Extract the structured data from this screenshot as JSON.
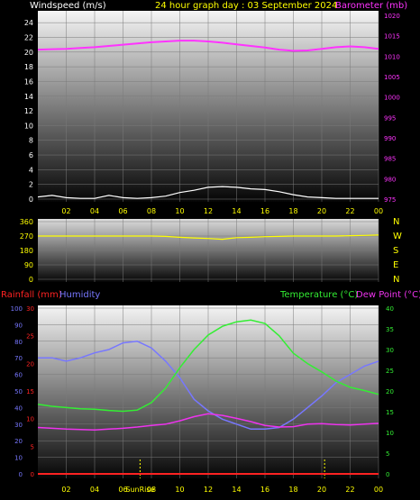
{
  "header": {
    "left_label": "Windspeed (m/s)",
    "center_label": "24 hour graph day : 03 September 2024",
    "right_label": "Barometer (mb)"
  },
  "middle": {
    "directions": [
      "N",
      "W",
      "S",
      "E",
      "N"
    ]
  },
  "bottom": {
    "rain_label": "Rainfall (mm)",
    "hum_label": "Humidity",
    "temp_label": "Temperature (°C)",
    "dew_label": "Dew Point (°C)",
    "sunrise_label": "SunRise"
  },
  "colors": {
    "wind": "#ffffff",
    "barometer": "#ff33ff",
    "direction": "#ffff00",
    "humidity": "#7777ff",
    "temperature": "#33ee33",
    "dewpoint": "#ee33ee",
    "rain": "#ff2222",
    "axis_text": "#ffff00"
  },
  "chart_data": [
    {
      "type": "line",
      "title": "24 hour graph day : 03 September 2024",
      "x": [
        0,
        1,
        2,
        3,
        4,
        5,
        6,
        7,
        8,
        9,
        10,
        11,
        12,
        13,
        14,
        15,
        16,
        17,
        18,
        19,
        20,
        21,
        22,
        23,
        24
      ],
      "x_ticks": [
        "02",
        "04",
        "06",
        "08",
        "10",
        "12",
        "14",
        "16",
        "18",
        "20",
        "22",
        "00"
      ],
      "y_left_label": "Windspeed (m/s)",
      "y_left_lim": [
        0,
        25
      ],
      "y_left_ticks": [
        0,
        2,
        4,
        6,
        8,
        10,
        12,
        14,
        16,
        18,
        20,
        22,
        24
      ],
      "y_right_label": "Barometer (mb)",
      "y_right_lim": [
        975,
        1020
      ],
      "y_right_ticks": [
        975,
        980,
        985,
        990,
        995,
        1000,
        1005,
        1010,
        1015,
        1020
      ],
      "series": [
        {
          "name": "Barometer (mb)",
          "axis": "right",
          "values": [
            1011.6,
            1011.7,
            1011.8,
            1012.0,
            1012.2,
            1012.5,
            1012.8,
            1013.1,
            1013.4,
            1013.6,
            1013.8,
            1013.8,
            1013.6,
            1013.3,
            1012.9,
            1012.5,
            1012.1,
            1011.6,
            1011.3,
            1011.4,
            1011.8,
            1012.2,
            1012.4,
            1012.2,
            1011.8
          ]
        },
        {
          "name": "Windspeed (m/s)",
          "axis": "left",
          "values": [
            0.3,
            0.5,
            0.2,
            0.1,
            0.1,
            0.5,
            0.2,
            0.1,
            0.2,
            0.4,
            0.9,
            1.2,
            1.6,
            1.7,
            1.6,
            1.4,
            1.3,
            1.0,
            0.6,
            0.3,
            0.2,
            0.1,
            0.1,
            0.1,
            0.1
          ]
        }
      ]
    },
    {
      "type": "line",
      "x": [
        0,
        1,
        2,
        3,
        4,
        5,
        6,
        7,
        8,
        9,
        10,
        11,
        12,
        13,
        14,
        15,
        16,
        17,
        18,
        19,
        20,
        21,
        22,
        23,
        24
      ],
      "y_lim": [
        0,
        360
      ],
      "y_ticks": [
        0,
        90,
        180,
        270,
        360
      ],
      "series": [
        {
          "name": "Wind Direction",
          "values": [
            270,
            270,
            270,
            270,
            270,
            270,
            270,
            270,
            270,
            268,
            262,
            258,
            255,
            250,
            260,
            262,
            266,
            268,
            270,
            270,
            270,
            270,
            272,
            274,
            276
          ]
        }
      ]
    },
    {
      "type": "line",
      "x": [
        0,
        1,
        2,
        3,
        4,
        5,
        6,
        7,
        8,
        9,
        10,
        11,
        12,
        13,
        14,
        15,
        16,
        17,
        18,
        19,
        20,
        21,
        22,
        23,
        24
      ],
      "x_ticks": [
        "02",
        "04",
        "06",
        "08",
        "10",
        "12",
        "14",
        "16",
        "18",
        "20",
        "22",
        "00"
      ],
      "y_left_label": "Rainfall (mm)",
      "y_left_lim": [
        0,
        30
      ],
      "y_hum_lim": [
        0,
        100
      ],
      "y_right_label": "Temperature (°C)",
      "y_right_lim": [
        0,
        40
      ],
      "series": [
        {
          "name": "Humidity",
          "axis": "hum",
          "values": [
            70,
            70,
            68,
            70,
            73,
            75,
            79,
            80,
            76,
            68,
            58,
            45,
            38,
            33,
            30,
            27,
            27,
            28,
            33,
            40,
            47,
            55,
            60,
            65,
            68
          ]
        },
        {
          "name": "Temperature (°C)",
          "axis": "right",
          "values": [
            16.8,
            16.3,
            16.0,
            15.7,
            15.6,
            15.3,
            15.1,
            15.4,
            17.2,
            20.7,
            25.6,
            30.0,
            33.5,
            35.6,
            36.7,
            37.1,
            36.3,
            33.3,
            29.1,
            26.6,
            24.6,
            22.4,
            20.9,
            20.1,
            19.2
          ]
        },
        {
          "name": "Dew Point (°C)",
          "axis": "right",
          "values": [
            11.2,
            11.0,
            10.8,
            10.7,
            10.6,
            10.8,
            11.0,
            11.3,
            11.7,
            12.0,
            12.8,
            13.8,
            14.5,
            14.1,
            13.4,
            12.6,
            11.7,
            11.3,
            11.4,
            12.0,
            12.1,
            11.9,
            11.8,
            12.0,
            12.2
          ]
        },
        {
          "name": "Rainfall (mm)",
          "axis": "left",
          "values": [
            0,
            0,
            0,
            0,
            0,
            0,
            0,
            0,
            0,
            0,
            0,
            0,
            0,
            0,
            0,
            0,
            0,
            0,
            0,
            0,
            0,
            0,
            0,
            0,
            0
          ]
        }
      ],
      "sunrise_hour": 7.2,
      "sunset_hour": 20.2
    }
  ]
}
